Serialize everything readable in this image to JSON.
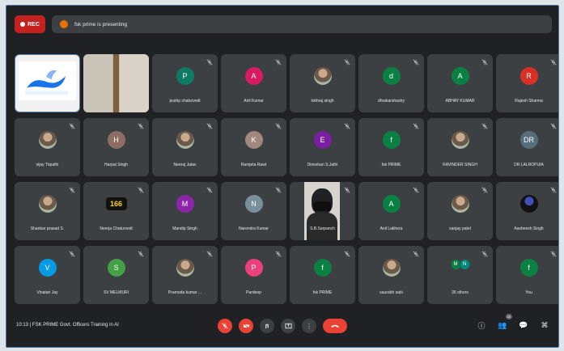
{
  "topbar": {
    "rec_label": "REC",
    "presenting_text": "fsk prime is presenting"
  },
  "participants": [
    {
      "name": "",
      "avatar": "",
      "color": "",
      "type": "shared"
    },
    {
      "name": "",
      "avatar": "",
      "color": "",
      "type": "camera"
    },
    {
      "name": "pushp chaturvedi",
      "avatar": "P",
      "color": "#0f7b63"
    },
    {
      "name": "Anil Kumar",
      "avatar": "A",
      "color": "#d81b60"
    },
    {
      "name": "lokhraj singh",
      "avatar": "",
      "color": "",
      "type": "photo"
    },
    {
      "name": "dhrakarshastry",
      "avatar": "d",
      "color": "#0b8043"
    },
    {
      "name": "ABHAY KUMAR",
      "avatar": "A",
      "color": "#0b8043"
    },
    {
      "name": "Rajesh Sharma",
      "avatar": "R",
      "color": "#d93025"
    },
    {
      "name": "vijay Tripathi",
      "avatar": "",
      "color": "",
      "type": "photo"
    },
    {
      "name": "Harpal Singh",
      "avatar": "H",
      "color": "#8d6e63"
    },
    {
      "name": "Neeraj Jatav",
      "avatar": "",
      "color": "",
      "type": "photo"
    },
    {
      "name": "Ramjeta Rawt",
      "avatar": "K",
      "color": "#a1887f"
    },
    {
      "name": "Dineshan S.Jathi",
      "avatar": "E",
      "color": "#7b1fa2"
    },
    {
      "name": "fsk PRIME",
      "avatar": "f",
      "color": "#0b8043"
    },
    {
      "name": "RAVINDER SINGH",
      "avatar": "",
      "color": "",
      "type": "photo"
    },
    {
      "name": "DR LALROPUIA",
      "avatar": "DR",
      "color": "#546e7a"
    },
    {
      "name": "Shankar prasad S.",
      "avatar": "",
      "color": "",
      "type": "photo"
    },
    {
      "name": "Neerja Chaturvedi",
      "avatar": "166",
      "color": "#f9ab00",
      "type": "sign"
    },
    {
      "name": "Mandip Singh",
      "avatar": "M",
      "color": "#8e24aa"
    },
    {
      "name": "Narendra Kumar",
      "avatar": "N",
      "color": "#78909c"
    },
    {
      "name": "S.B.Sarpanch",
      "avatar": "",
      "color": "",
      "type": "video"
    },
    {
      "name": "Anil Lakhera",
      "avatar": "A",
      "color": "#0b8043"
    },
    {
      "name": "sanjay patel",
      "avatar": "",
      "color": "",
      "type": "photo"
    },
    {
      "name": "Aasheesh Singh",
      "avatar": "",
      "color": "",
      "type": "photo-dark"
    },
    {
      "name": "Vinatan Jay",
      "avatar": "V",
      "color": "#039be5"
    },
    {
      "name": "SV MELMURI",
      "avatar": "S",
      "color": "#43a047"
    },
    {
      "name": "Pramoda kumar ...",
      "avatar": "",
      "color": "",
      "type": "photo"
    },
    {
      "name": "Pardeep",
      "avatar": "P",
      "color": "#ec407a"
    },
    {
      "name": "fsk PRIME",
      "avatar": "f",
      "color": "#0b8043"
    },
    {
      "name": "saurabh sabi",
      "avatar": "",
      "color": "",
      "type": "photo"
    },
    {
      "name": "35 others",
      "avatar": "M",
      "color": "#0b8043",
      "type": "others",
      "second": "N",
      "second_color": "#00897b"
    },
    {
      "name": "You",
      "avatar": "f",
      "color": "#0b8043"
    }
  ],
  "bottombar": {
    "time": "10:13",
    "separator": "|",
    "meeting_title": "FSK PRIME Govt. Officers Training in AI",
    "controls": [
      "mic-off",
      "camera-off",
      "hand",
      "present",
      "more",
      "leave-call"
    ],
    "badge_count": "35"
  }
}
